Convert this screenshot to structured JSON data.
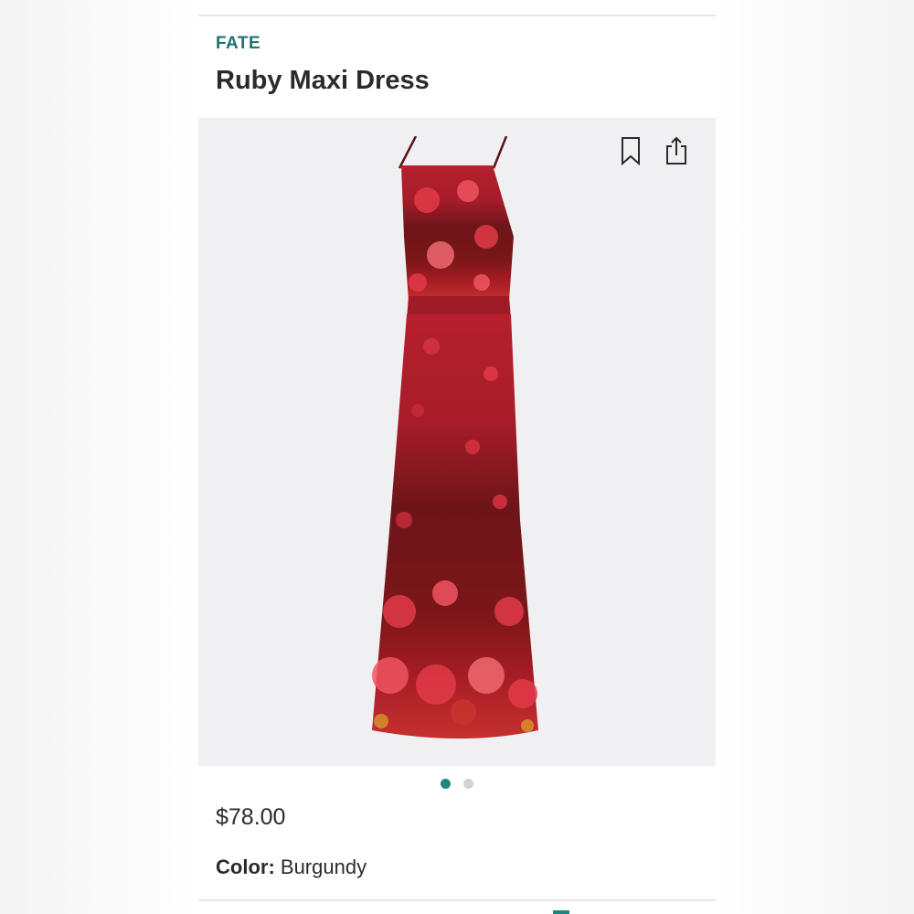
{
  "product": {
    "brand": "FATE",
    "name": "Ruby Maxi Dress",
    "price": "$78.00",
    "color_label": "Color:",
    "color_value": "Burgundy"
  },
  "gallery": {
    "image": "burgundy floral maxi dress",
    "dots": [
      {
        "active": true
      },
      {
        "active": false
      }
    ]
  },
  "icons": {
    "bookmark": "bookmark-icon",
    "share": "share-icon"
  },
  "colors": {
    "brand_teal": "#1f7473",
    "active_dot": "#1f8583",
    "inactive_dot": "#d3d3d3",
    "image_bg": "#f0f0f2",
    "text": "#2b2b2b"
  }
}
